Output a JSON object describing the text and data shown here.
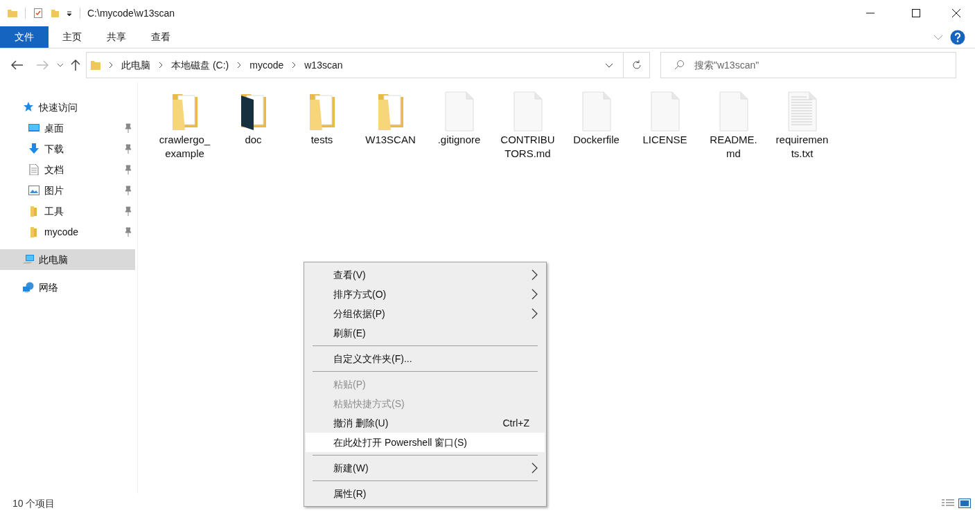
{
  "window": {
    "title": "C:\\mycode\\w13scan"
  },
  "ribbon_tabs": [
    {
      "label": "文件",
      "kind": "file"
    },
    {
      "label": "主页",
      "kind": "tab"
    },
    {
      "label": "共享",
      "kind": "tab"
    },
    {
      "label": "查看",
      "kind": "tab"
    }
  ],
  "address_bar": {
    "breadcrumbs": [
      "此电脑",
      "本地磁盘 (C:)",
      "mycode",
      "w13scan"
    ]
  },
  "search": {
    "placeholder": "搜索\"w13scan\""
  },
  "sidebar": {
    "items": [
      {
        "label": "快速访问",
        "kind": "star",
        "selected": false,
        "children": [
          {
            "label": "桌面",
            "kind": "desktop",
            "pinned": true,
            "selected": false
          },
          {
            "label": "下载",
            "kind": "download",
            "pinned": true,
            "selected": false
          },
          {
            "label": "文档",
            "kind": "document",
            "pinned": true,
            "selected": false
          },
          {
            "label": "图片",
            "kind": "pictures",
            "pinned": true,
            "selected": false
          },
          {
            "label": "工具",
            "kind": "folder",
            "pinned": true,
            "selected": false
          },
          {
            "label": "mycode",
            "kind": "folder",
            "pinned": true,
            "selected": false
          }
        ]
      },
      {
        "label": "此电脑",
        "kind": "computer",
        "selected": true
      },
      {
        "label": "网络",
        "kind": "network",
        "selected": false
      }
    ]
  },
  "files": [
    {
      "name": "crawlergo_example",
      "kind": "folder"
    },
    {
      "name": "doc",
      "kind": "folder_dark"
    },
    {
      "name": "tests",
      "kind": "folder"
    },
    {
      "name": "W13SCAN",
      "kind": "folder"
    },
    {
      "name": ".gitignore",
      "kind": "file"
    },
    {
      "name": "CONTRIBUTORS.md",
      "kind": "file"
    },
    {
      "name": "Dockerfile",
      "kind": "file"
    },
    {
      "name": "LICENSE",
      "kind": "file"
    },
    {
      "name": "README.md",
      "kind": "file"
    },
    {
      "name": "requirements.txt",
      "kind": "text"
    }
  ],
  "context_menu": {
    "items": [
      {
        "kind": "item",
        "label": "查看(V)",
        "submenu": true,
        "disabled": false,
        "selected": false
      },
      {
        "kind": "item",
        "label": "排序方式(O)",
        "submenu": true,
        "disabled": false,
        "selected": false
      },
      {
        "kind": "item",
        "label": "分组依据(P)",
        "submenu": true,
        "disabled": false,
        "selected": false
      },
      {
        "kind": "item",
        "label": "刷新(E)",
        "submenu": false,
        "disabled": false,
        "selected": false
      },
      {
        "kind": "separator"
      },
      {
        "kind": "item",
        "label": "自定义文件夹(F)...",
        "submenu": false,
        "disabled": false,
        "selected": false
      },
      {
        "kind": "separator"
      },
      {
        "kind": "item",
        "label": "粘贴(P)",
        "submenu": false,
        "disabled": true,
        "selected": false
      },
      {
        "kind": "item",
        "label": "粘贴快捷方式(S)",
        "submenu": false,
        "disabled": true,
        "selected": false
      },
      {
        "kind": "item",
        "label": "撤消 删除(U)",
        "shortcut": "Ctrl+Z",
        "submenu": false,
        "disabled": false,
        "selected": false
      },
      {
        "kind": "item",
        "label": "在此处打开 Powershell 窗口(S)",
        "submenu": false,
        "disabled": false,
        "selected": true
      },
      {
        "kind": "separator"
      },
      {
        "kind": "item",
        "label": "新建(W)",
        "submenu": true,
        "disabled": false,
        "selected": false
      },
      {
        "kind": "separator"
      },
      {
        "kind": "item",
        "label": "属性(R)",
        "submenu": false,
        "disabled": false,
        "selected": false
      }
    ]
  },
  "status_bar": {
    "item_count": "10 个项目"
  }
}
